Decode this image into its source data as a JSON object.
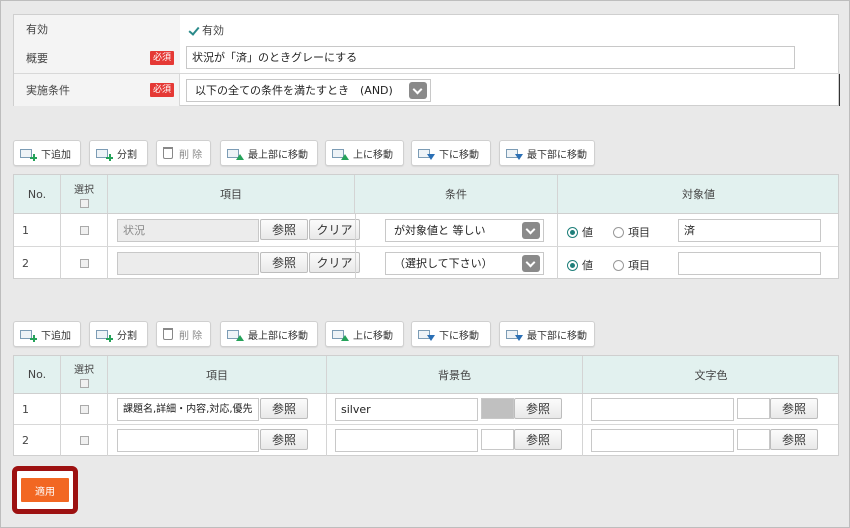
{
  "form": {
    "enabled_label": "有効",
    "enabled_checkbox_label": "有効",
    "summary_label": "概要",
    "required_badge": "必須",
    "summary_value": "状況が「済」のときグレーにする",
    "condition_label": "実施条件",
    "condition_value": "以下の全ての条件を満たすとき　(AND)"
  },
  "toolbar": {
    "add_below": "下追加",
    "split": "分割",
    "delete": "削 除",
    "move_top": "最上部に移動",
    "move_up": "上に移動",
    "move_down": "下に移動",
    "move_bottom": "最下部に移動"
  },
  "condition_table": {
    "headers": {
      "no": "No.",
      "select": "選択",
      "item": "項目",
      "condition": "条件",
      "target": "対象値"
    },
    "rows": [
      {
        "no": "1",
        "item": "状況",
        "item_placeholder": "",
        "browse": "参照",
        "clear": "クリア",
        "condition": "が対象値と 等しい",
        "radio_value": "値",
        "radio_item": "項目",
        "target": "済"
      },
      {
        "no": "2",
        "item": "",
        "browse": "参照",
        "clear": "クリア",
        "condition": "（選択して下さい）",
        "radio_value": "値",
        "radio_item": "項目",
        "target": ""
      }
    ]
  },
  "style_table": {
    "headers": {
      "no": "No.",
      "select": "選択",
      "item": "項目",
      "bg": "背景色",
      "fg": "文字色"
    },
    "rows": [
      {
        "no": "1",
        "item": "課題名,詳細・内容,対応,優先",
        "browse": "参照",
        "bg_value": "silver",
        "bg_swatch": "#c0c0c0",
        "bg_browse": "参照",
        "fg_value": "",
        "fg_browse": "参照"
      },
      {
        "no": "2",
        "item": "",
        "browse": "参照",
        "bg_value": "",
        "bg_swatch": "#ffffff",
        "bg_browse": "参照",
        "fg_value": "",
        "fg_browse": "参照"
      }
    ]
  },
  "apply_label": "適用"
}
